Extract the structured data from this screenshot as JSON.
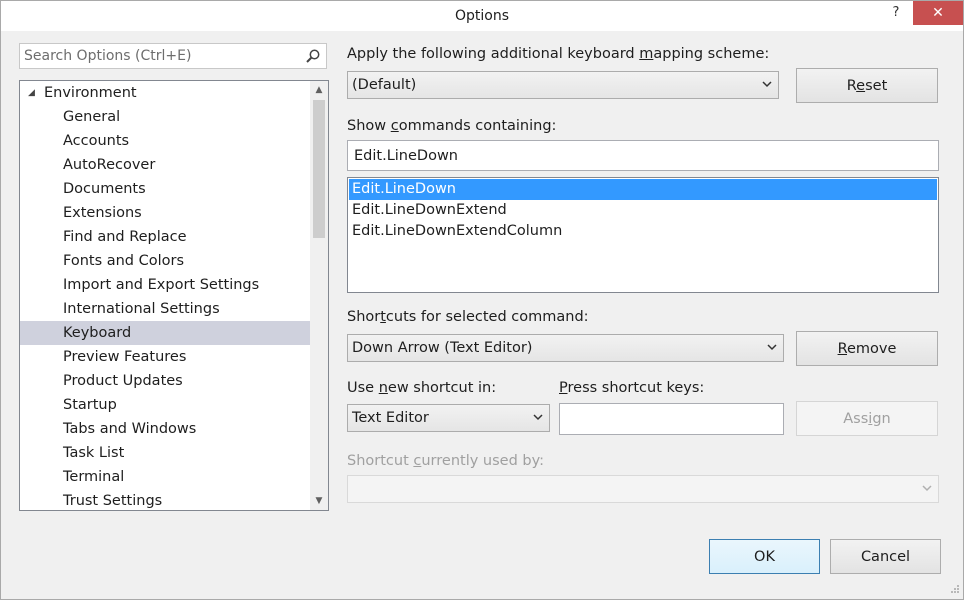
{
  "window": {
    "title": "Options",
    "help_glyph": "?",
    "close_glyph": "✕"
  },
  "search": {
    "placeholder": "Search Options (Ctrl+E)"
  },
  "tree": {
    "root": "Environment",
    "items": [
      "General",
      "Accounts",
      "AutoRecover",
      "Documents",
      "Extensions",
      "Find and Replace",
      "Fonts and Colors",
      "Import and Export Settings",
      "International Settings",
      "Keyboard",
      "Preview Features",
      "Product Updates",
      "Startup",
      "Tabs and Windows",
      "Task List",
      "Terminal",
      "Trust Settings"
    ],
    "selected": "Keyboard"
  },
  "mapping": {
    "label_pre": "Apply the following additional keyboard ",
    "label_key": "m",
    "label_post": "apping scheme:",
    "value": "(Default)",
    "reset_pre": "R",
    "reset_key": "e",
    "reset_post": "set"
  },
  "commands": {
    "label_pre": "Show ",
    "label_key": "c",
    "label_post": "ommands containing:",
    "filter": "Edit.LineDown",
    "list": [
      "Edit.LineDown",
      "Edit.LineDownExtend",
      "Edit.LineDownExtendColumn"
    ],
    "selected": "Edit.LineDown"
  },
  "shortcuts": {
    "label_pre": "Shor",
    "label_key": "t",
    "label_post": "cuts for selected command:",
    "value": "Down Arrow (Text Editor)",
    "remove_key": "R",
    "remove_post": "emove"
  },
  "new_shortcut": {
    "label_pre": "Use ",
    "label_key": "n",
    "label_post": "ew shortcut in:",
    "value": "Text Editor"
  },
  "press_keys": {
    "label_key": "P",
    "label_post": "ress shortcut keys:",
    "value": ""
  },
  "assign": {
    "pre": "Ass",
    "key": "i",
    "post": "gn"
  },
  "used_by": {
    "label_pre": "Shortcut ",
    "label_key": "c",
    "label_post": "urrently used by:",
    "value": ""
  },
  "footer": {
    "ok": "OK",
    "cancel": "Cancel"
  },
  "icons": {
    "search": "magnifier-icon",
    "expand": "caret-down-icon",
    "dropdown": "chevron-down-icon"
  }
}
